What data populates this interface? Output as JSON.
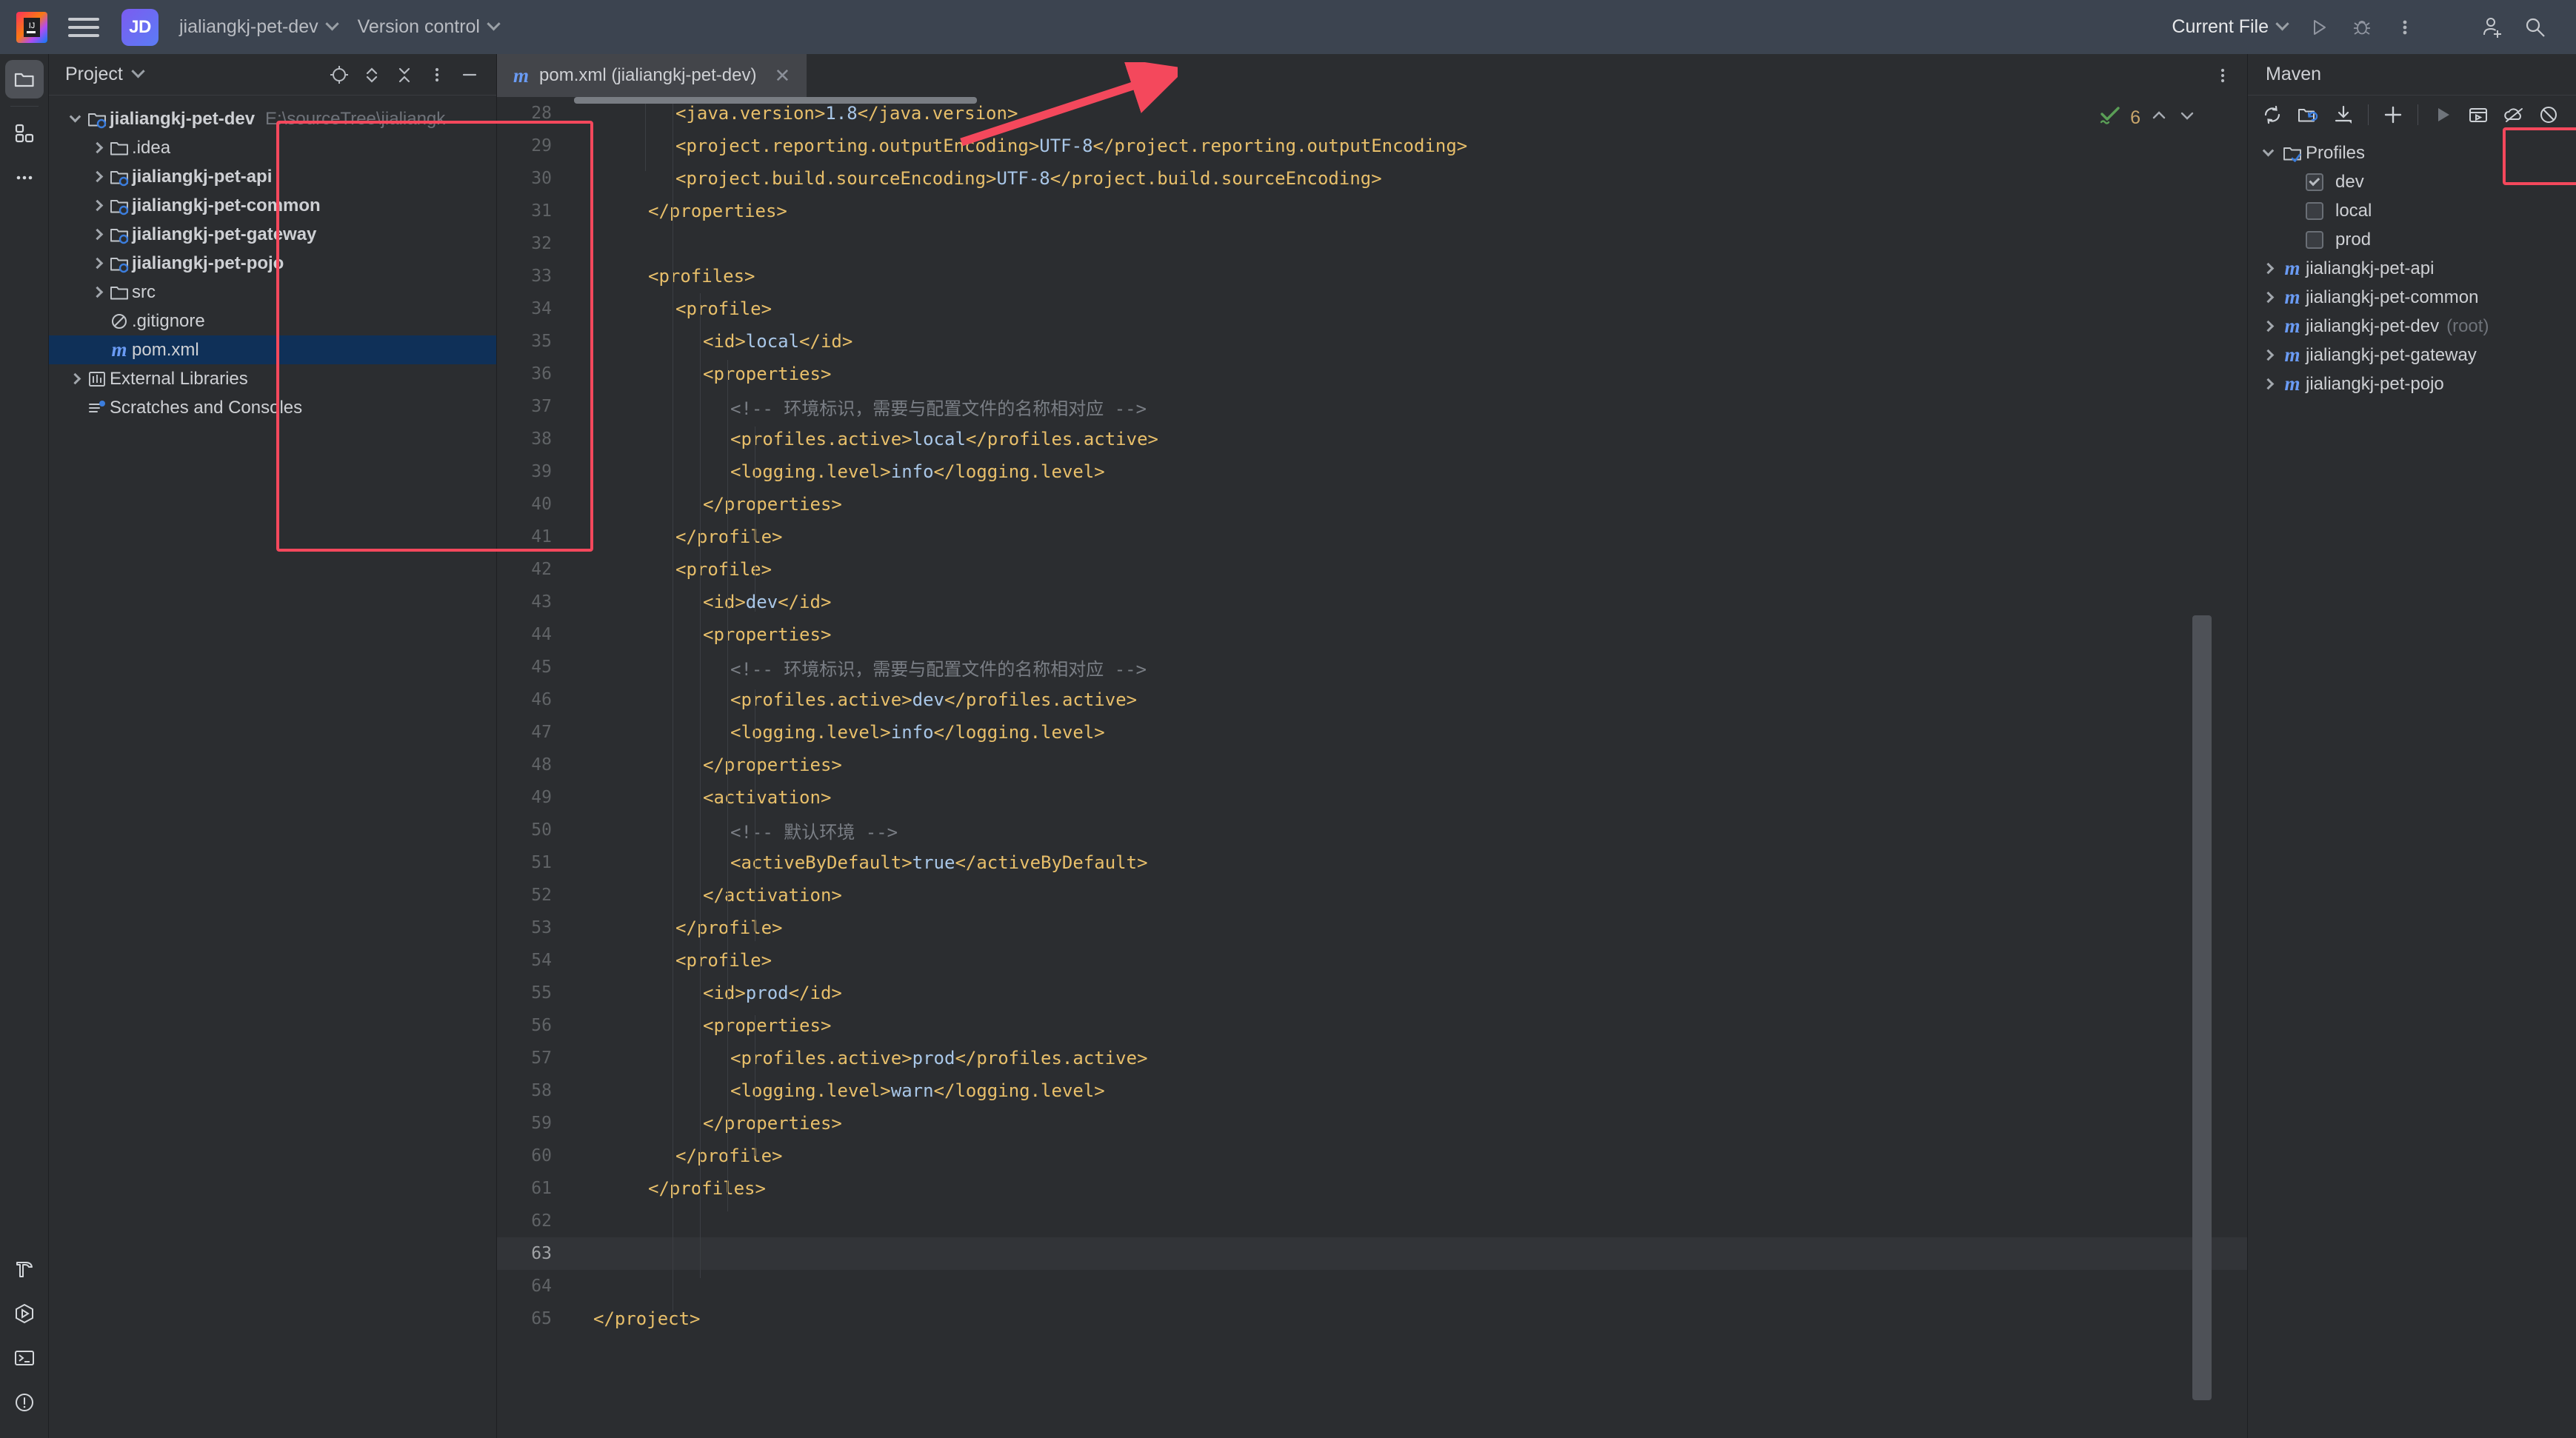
{
  "titlebar": {
    "logo_icon": "intellij-idea-logo",
    "menu_icon": "hamburger-menu-icon",
    "project_badge": "JD",
    "project_name": "jialiangkj-pet-dev",
    "version_control": "Version control",
    "run_config": "Current File",
    "run_icon": "run-play-icon",
    "debug_icon": "debug-bug-icon",
    "more_icon": "more-vertical-icon",
    "add_user_icon": "add-user-icon",
    "search_icon": "search-icon"
  },
  "toolstrip": {
    "items": [
      {
        "name": "project-tool-icon",
        "active": true
      },
      {
        "name": "structure-tool-icon",
        "active": false
      },
      {
        "name": "more-tool-icon",
        "active": false
      }
    ],
    "bottom_items": [
      {
        "name": "build-hammer-icon"
      },
      {
        "name": "run-hexagon-icon"
      },
      {
        "name": "terminal-icon"
      },
      {
        "name": "problems-icon"
      }
    ]
  },
  "project_panel": {
    "title": "Project",
    "title_chevron": "chevron-down-icon",
    "header_icons": [
      "locate-target-icon",
      "expand-collapse-icon",
      "collapse-all-icon",
      "options-menu-icon",
      "hide-panel-icon"
    ],
    "tree": [
      {
        "indent": 0,
        "arrow": "down",
        "icon": "module-folder",
        "label": "jialiangkj-pet-dev",
        "bold": true,
        "path": "E:\\sourceTree\\jialiangk",
        "selected": false
      },
      {
        "indent": 1,
        "arrow": "right",
        "icon": "folder",
        "label": ".idea",
        "bold": false,
        "path": "",
        "selected": false
      },
      {
        "indent": 1,
        "arrow": "right",
        "icon": "module-folder",
        "label": "jialiangkj-pet-api",
        "bold": true,
        "path": "",
        "selected": false
      },
      {
        "indent": 1,
        "arrow": "right",
        "icon": "module-folder",
        "label": "jialiangkj-pet-common",
        "bold": true,
        "path": "",
        "selected": false
      },
      {
        "indent": 1,
        "arrow": "right",
        "icon": "module-folder",
        "label": "jialiangkj-pet-gateway",
        "bold": true,
        "path": "",
        "selected": false
      },
      {
        "indent": 1,
        "arrow": "right",
        "icon": "module-folder",
        "label": "jialiangkj-pet-pojo",
        "bold": true,
        "path": "",
        "selected": false
      },
      {
        "indent": 1,
        "arrow": "right",
        "icon": "folder",
        "label": "src",
        "bold": false,
        "path": "",
        "selected": false
      },
      {
        "indent": 1,
        "arrow": "none",
        "icon": "gitignore",
        "label": ".gitignore",
        "bold": false,
        "path": "",
        "selected": false
      },
      {
        "indent": 1,
        "arrow": "none",
        "icon": "maven-m",
        "label": "pom.xml",
        "bold": false,
        "path": "",
        "selected": true
      },
      {
        "indent": 0,
        "arrow": "right",
        "icon": "libraries",
        "label": "External Libraries",
        "bold": false,
        "path": "",
        "selected": false
      },
      {
        "indent": 0,
        "arrow": "none",
        "icon": "scratches",
        "label": "Scratches and Consoles",
        "bold": false,
        "path": "",
        "selected": false
      }
    ]
  },
  "editor": {
    "tab": {
      "icon": "maven-m",
      "label": "pom.xml (jialiangkj-pet-dev)",
      "close_icon": "close-x-icon"
    },
    "tab_more_icon": "more-vertical-icon",
    "inspection": {
      "icon": "inspection-ok-icon",
      "count": "6",
      "up_icon": "chevron-up-icon",
      "down_icon": "chevron-down-icon"
    },
    "caret_line": 63,
    "lines": [
      {
        "n": 28,
        "indent": 3,
        "parts": [
          {
            "t": "<java.version>",
            "c": "tg"
          },
          {
            "t": "1.8",
            "c": "tx"
          },
          {
            "t": "</java.version>",
            "c": "tg"
          }
        ]
      },
      {
        "n": 29,
        "indent": 3,
        "parts": [
          {
            "t": "<project.reporting.outputEncoding>",
            "c": "tg"
          },
          {
            "t": "UTF-8",
            "c": "tx"
          },
          {
            "t": "</project.reporting.outputEncoding>",
            "c": "tg"
          }
        ]
      },
      {
        "n": 30,
        "indent": 3,
        "parts": [
          {
            "t": "<project.build.sourceEncoding>",
            "c": "tg"
          },
          {
            "t": "UTF-8",
            "c": "tx"
          },
          {
            "t": "</project.build.sourceEncoding>",
            "c": "tg"
          }
        ]
      },
      {
        "n": 31,
        "indent": 2,
        "parts": [
          {
            "t": "</properties>",
            "c": "tg"
          }
        ]
      },
      {
        "n": 32,
        "indent": 0,
        "parts": []
      },
      {
        "n": 33,
        "indent": 2,
        "parts": [
          {
            "t": "<profiles>",
            "c": "tg"
          }
        ]
      },
      {
        "n": 34,
        "indent": 3,
        "parts": [
          {
            "t": "<profile>",
            "c": "tg"
          }
        ]
      },
      {
        "n": 35,
        "indent": 4,
        "parts": [
          {
            "t": "<id>",
            "c": "tg"
          },
          {
            "t": "local",
            "c": "tx"
          },
          {
            "t": "</id>",
            "c": "tg"
          }
        ]
      },
      {
        "n": 36,
        "indent": 4,
        "parts": [
          {
            "t": "<properties>",
            "c": "tg"
          }
        ]
      },
      {
        "n": 37,
        "indent": 5,
        "parts": [
          {
            "t": "<!-- 环境标识，需要与配置文件的名称相对应 -->",
            "c": "cm"
          }
        ]
      },
      {
        "n": 38,
        "indent": 5,
        "parts": [
          {
            "t": "<profiles.active>",
            "c": "tg"
          },
          {
            "t": "local",
            "c": "tx"
          },
          {
            "t": "</profiles.active>",
            "c": "tg"
          }
        ]
      },
      {
        "n": 39,
        "indent": 5,
        "parts": [
          {
            "t": "<logging.level>",
            "c": "tg"
          },
          {
            "t": "info",
            "c": "tx"
          },
          {
            "t": "</logging.level>",
            "c": "tg"
          }
        ]
      },
      {
        "n": 40,
        "indent": 4,
        "parts": [
          {
            "t": "</properties>",
            "c": "tg"
          }
        ]
      },
      {
        "n": 41,
        "indent": 3,
        "parts": [
          {
            "t": "</profile>",
            "c": "tg"
          }
        ]
      },
      {
        "n": 42,
        "indent": 3,
        "parts": [
          {
            "t": "<profile>",
            "c": "tg"
          }
        ]
      },
      {
        "n": 43,
        "indent": 4,
        "parts": [
          {
            "t": "<id>",
            "c": "tg"
          },
          {
            "t": "dev",
            "c": "tx"
          },
          {
            "t": "</id>",
            "c": "tg"
          }
        ]
      },
      {
        "n": 44,
        "indent": 4,
        "parts": [
          {
            "t": "<properties>",
            "c": "tg"
          }
        ]
      },
      {
        "n": 45,
        "indent": 5,
        "parts": [
          {
            "t": "<!-- 环境标识，需要与配置文件的名称相对应 -->",
            "c": "cm"
          }
        ]
      },
      {
        "n": 46,
        "indent": 5,
        "parts": [
          {
            "t": "<profiles.active>",
            "c": "tg"
          },
          {
            "t": "dev",
            "c": "tx"
          },
          {
            "t": "</profiles.active>",
            "c": "tg"
          }
        ]
      },
      {
        "n": 47,
        "indent": 5,
        "parts": [
          {
            "t": "<logging.level>",
            "c": "tg"
          },
          {
            "t": "info",
            "c": "tx"
          },
          {
            "t": "</logging.level>",
            "c": "tg"
          }
        ]
      },
      {
        "n": 48,
        "indent": 4,
        "parts": [
          {
            "t": "</properties>",
            "c": "tg"
          }
        ]
      },
      {
        "n": 49,
        "indent": 4,
        "parts": [
          {
            "t": "<activation>",
            "c": "tg"
          }
        ]
      },
      {
        "n": 50,
        "indent": 5,
        "parts": [
          {
            "t": "<!-- 默认环境 -->",
            "c": "cm"
          }
        ]
      },
      {
        "n": 51,
        "indent": 5,
        "parts": [
          {
            "t": "<activeByDefault>",
            "c": "tg"
          },
          {
            "t": "true",
            "c": "tx"
          },
          {
            "t": "</activeByDefault>",
            "c": "tg"
          }
        ]
      },
      {
        "n": 52,
        "indent": 4,
        "parts": [
          {
            "t": "</activation>",
            "c": "tg"
          }
        ]
      },
      {
        "n": 53,
        "indent": 3,
        "parts": [
          {
            "t": "</profile>",
            "c": "tg"
          }
        ]
      },
      {
        "n": 54,
        "indent": 3,
        "parts": [
          {
            "t": "<profile>",
            "c": "tg"
          }
        ]
      },
      {
        "n": 55,
        "indent": 4,
        "parts": [
          {
            "t": "<id>",
            "c": "tg"
          },
          {
            "t": "prod",
            "c": "tx"
          },
          {
            "t": "</id>",
            "c": "tg"
          }
        ]
      },
      {
        "n": 56,
        "indent": 4,
        "parts": [
          {
            "t": "<properties>",
            "c": "tg"
          }
        ]
      },
      {
        "n": 57,
        "indent": 5,
        "parts": [
          {
            "t": "<profiles.active>",
            "c": "tg"
          },
          {
            "t": "prod",
            "c": "tx"
          },
          {
            "t": "</profiles.active>",
            "c": "tg"
          }
        ]
      },
      {
        "n": 58,
        "indent": 5,
        "parts": [
          {
            "t": "<logging.level>",
            "c": "tg"
          },
          {
            "t": "warn",
            "c": "tx"
          },
          {
            "t": "</logging.level>",
            "c": "tg"
          }
        ]
      },
      {
        "n": 59,
        "indent": 4,
        "parts": [
          {
            "t": "</properties>",
            "c": "tg"
          }
        ]
      },
      {
        "n": 60,
        "indent": 3,
        "parts": [
          {
            "t": "</profile>",
            "c": "tg"
          }
        ]
      },
      {
        "n": 61,
        "indent": 2,
        "parts": [
          {
            "t": "</profiles>",
            "c": "tg"
          }
        ]
      },
      {
        "n": 62,
        "indent": 0,
        "parts": []
      },
      {
        "n": 63,
        "indent": 0,
        "parts": []
      },
      {
        "n": 64,
        "indent": 0,
        "parts": []
      },
      {
        "n": 65,
        "indent": 0,
        "parts": [
          {
            "t": "</project>",
            "c": "tg"
          }
        ]
      }
    ]
  },
  "maven_panel": {
    "title": "Maven",
    "toolbar_icons": [
      "reload-all-maven-projects-icon",
      "add-maven-project-icon",
      "download-sources-icon",
      "add-icon",
      "run-icon",
      "execute-maven-goal-icon",
      "toggle-offline-mode-icon",
      "skip-tests-icon"
    ],
    "tree": [
      {
        "type": "group",
        "arrow": "down",
        "icon": "profiles-folder-icon",
        "label": "Profiles"
      },
      {
        "type": "profile",
        "checked": true,
        "label": "dev"
      },
      {
        "type": "profile",
        "checked": false,
        "label": "local"
      },
      {
        "type": "profile",
        "checked": false,
        "label": "prod"
      },
      {
        "type": "module",
        "arrow": "right",
        "icon": "maven-m",
        "label": "jialiangkj-pet-api",
        "suffix": ""
      },
      {
        "type": "module",
        "arrow": "right",
        "icon": "maven-m",
        "label": "jialiangkj-pet-common",
        "suffix": ""
      },
      {
        "type": "module",
        "arrow": "right",
        "icon": "maven-m",
        "label": "jialiangkj-pet-dev",
        "suffix": "(root)"
      },
      {
        "type": "module",
        "arrow": "right",
        "icon": "maven-m",
        "label": "jialiangkj-pet-gateway",
        "suffix": ""
      },
      {
        "type": "module",
        "arrow": "right",
        "icon": "maven-m",
        "label": "jialiangkj-pet-pojo",
        "suffix": ""
      }
    ]
  },
  "annotations": {
    "highlight_color": "#f4485c",
    "code_box_label": "profiles-block-highlight",
    "profiles_box_label": "maven-profiles-highlight",
    "arrow_label": "arrow-to-reload-maven-button"
  },
  "colors": {
    "titlebar_bg": "#3c4450",
    "panel_bg": "#2b2d30",
    "editor_bg": "#2b2d30",
    "selection_bg": "#0f3058",
    "tag": "#e8bf6a",
    "value": "#a9c7e8",
    "comment": "#7a7e85",
    "accent_red": "#f4485c",
    "maven_blue": "#6a9bf4"
  }
}
